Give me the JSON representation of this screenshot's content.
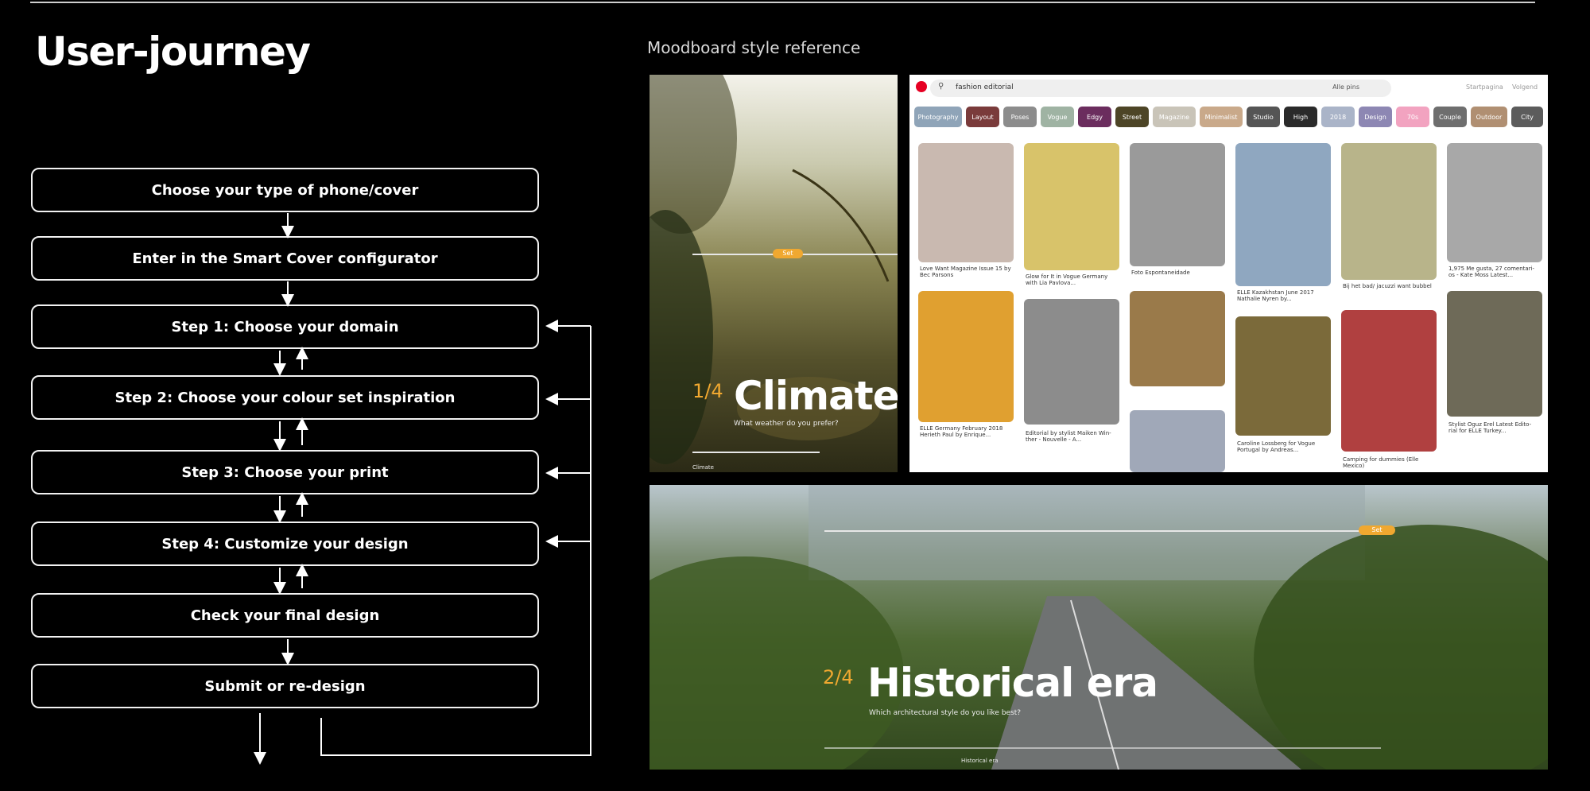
{
  "title": "User-journey",
  "moodboard_label": "Moodboard style reference",
  "steps": [
    "Choose your type of phone/cover",
    "Enter in the Smart Cover configurator",
    "Step 1: Choose your domain",
    "Step 2: Choose your colour  set inspiration",
    "Step 3: Choose your print",
    "Step 4: Customize your design",
    "Check your final design",
    "Submit or re-design"
  ],
  "climate": {
    "fraction": "1/4",
    "word": "Climate",
    "question": "What weather do you prefer?",
    "footer": "Climate",
    "set": "Set"
  },
  "historical": {
    "fraction": "2/4",
    "word": "Historical era",
    "question": "Which architectural style do you like best?",
    "footer": "Historical era",
    "set": "Set"
  },
  "pinterest": {
    "search": "fashion editorial",
    "filter": "Alle pins",
    "nav": [
      "Startpagina",
      "Volgend"
    ],
    "chips": [
      "Photography",
      "Layout",
      "Poses",
      "Vogue",
      "Edgy",
      "Street",
      "Magazine",
      "Minimalist",
      "Studio",
      "High",
      "2018",
      "Design",
      "70s",
      "Couple",
      "Outdoor",
      "City"
    ],
    "chip_colors": [
      "#8fa4b8",
      "#7a3b3b",
      "#8c8c8c",
      "#9fb3a3",
      "#6b2d5e",
      "#4d4526",
      "#c9c4b8",
      "#c9a98a",
      "#555555",
      "#2a2a2a",
      "#aab4c8",
      "#8d87b3",
      "#f2a3c0",
      "#6e6e6e",
      "#b08f72",
      "#5c5c5c"
    ],
    "captions": [
      "Love Want Magazine Issue 15 by Bec Parsons",
      "Glow for It in Vogue Germany with Lia Pavlova...",
      "Foto Espontaneidade",
      "ELLE Kazakhstan June 2017 Nathalie Nyren by...",
      "Bij het bad/ jacuzzi want bubbel",
      "1,975 Me gusta, 27 comentari-os - Kate Moss Latest...",
      "ELLE Germany February 2018 Herieth Paul by Enrique...",
      "Editorial by stylist Maiken Win-ther - Nouvelle - A...",
      "Caroline Lossberg for Vogue Portugal by Andreas...",
      "Camping for dummies (Elle Mexico)",
      "Stylist Oguz Erel Latest Edito-rial for ELLE Turkey..."
    ]
  }
}
